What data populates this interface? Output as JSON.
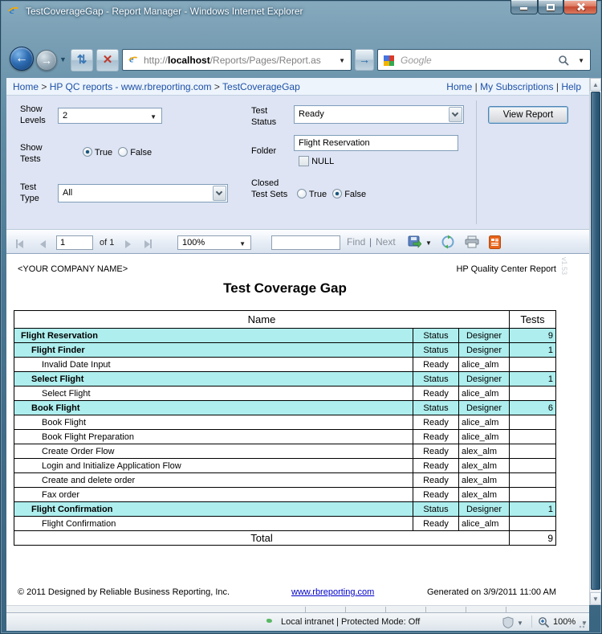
{
  "window": {
    "title": "TestCoverageGap - Report Manager - Windows Internet Explorer"
  },
  "nav": {
    "url_protocol": "http://",
    "url_host": "localhost",
    "url_path": "/Reports/Pages/Report.as",
    "search_placeholder": "Google"
  },
  "tab": {
    "label": "TestCoverageGap - Report Manager"
  },
  "breadcrumb": {
    "separator": ">",
    "items": [
      "Home",
      "HP QC reports - www.rbreporting.com",
      "TestCoverageGap"
    ]
  },
  "quick_links": {
    "home": "Home",
    "subscriptions": "My Subscriptions",
    "help": "Help",
    "separator": "|"
  },
  "form": {
    "show_levels_label": "Show Levels",
    "show_levels_value": "2",
    "show_tests_label": "Show Tests",
    "true_label": "True",
    "false_label": "False",
    "show_tests_selected": "True",
    "test_type_label": "Test Type",
    "test_type_value": "All",
    "test_status_label": "Test Status",
    "test_status_value": "Ready",
    "folder_label": "Folder",
    "folder_value": "Flight Reservation",
    "null_label": "NULL",
    "folder_null_checked": false,
    "closed_test_sets_label": "Closed Test Sets",
    "closed_test_sets_selected": "False",
    "view_report_label": "View Report"
  },
  "toolbar": {
    "page_value": "1",
    "of_label": "of 1",
    "zoom_value": "100%",
    "find_value": "",
    "find_label": "Find",
    "separator": "|",
    "next_label": "Next"
  },
  "report": {
    "company": "<YOUR COMPANY NAME>",
    "header_right": "HP Quality Center Report",
    "version": "v1.53",
    "title": "Test Coverage Gap",
    "table": {
      "name_header": "Name",
      "tests_header": "Tests",
      "rows": [
        {
          "name": "Flight Reservation",
          "level": 0,
          "group": true,
          "status": "Status",
          "designer": "Designer",
          "tests": "9"
        },
        {
          "name": "Flight Finder",
          "level": 1,
          "group": true,
          "status": "Status",
          "designer": "Designer",
          "tests": "1"
        },
        {
          "name": "Invalid Date Input",
          "level": 2,
          "group": false,
          "status": "Ready",
          "designer": "alice_alm",
          "tests": ""
        },
        {
          "name": "Select Flight",
          "level": 1,
          "group": true,
          "status": "Status",
          "designer": "Designer",
          "tests": "1"
        },
        {
          "name": "Select Flight",
          "level": 2,
          "group": false,
          "status": "Ready",
          "designer": "alice_alm",
          "tests": ""
        },
        {
          "name": "Book Flight",
          "level": 1,
          "group": true,
          "status": "Status",
          "designer": "Designer",
          "tests": "6"
        },
        {
          "name": "Book Flight",
          "level": 2,
          "group": false,
          "status": "Ready",
          "designer": "alice_alm",
          "tests": ""
        },
        {
          "name": "Book Flight Preparation",
          "level": 2,
          "group": false,
          "status": "Ready",
          "designer": "alice_alm",
          "tests": ""
        },
        {
          "name": "Create Order Flow",
          "level": 2,
          "group": false,
          "status": "Ready",
          "designer": "alex_alm",
          "tests": ""
        },
        {
          "name": "Login and Initialize Application Flow",
          "level": 2,
          "group": false,
          "status": "Ready",
          "designer": "alex_alm",
          "tests": ""
        },
        {
          "name": "Create and delete order",
          "level": 2,
          "group": false,
          "status": "Ready",
          "designer": "alex_alm",
          "tests": ""
        },
        {
          "name": "Fax order",
          "level": 2,
          "group": false,
          "status": "Ready",
          "designer": "alex_alm",
          "tests": ""
        },
        {
          "name": "Flight Confirmation",
          "level": 1,
          "group": true,
          "status": "Status",
          "designer": "Designer",
          "tests": "1"
        },
        {
          "name": "Flight Confirmation",
          "level": 2,
          "group": false,
          "status": "Ready",
          "designer": "alice_alm",
          "tests": ""
        }
      ],
      "total_label": "Total",
      "total_value": "9"
    },
    "footer": {
      "copyright": "© 2011 Designed by Reliable Business Reporting, Inc.",
      "link": "www.rbreporting.com",
      "generated": "Generated on 3/9/2011 11:00 AM"
    }
  },
  "statusbar": {
    "zone_text": "Local intranet | Protected Mode: Off",
    "zoom_text": "100%"
  },
  "colors": {
    "group_row_cyan": "#AEEEEE",
    "link_blue": "#1D50A8",
    "close_button_red": "#D9594C",
    "chrome_teal": "#4A7793",
    "form_band": "#DEE4F3"
  }
}
